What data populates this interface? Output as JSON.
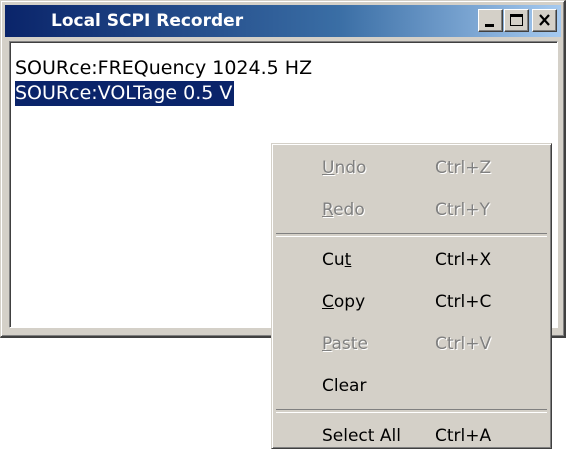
{
  "window": {
    "title": "Local SCPI Recorder",
    "controls": {
      "minimize_icon": "minimize-icon",
      "maximize_icon": "maximize-icon",
      "close_icon": "close-icon"
    }
  },
  "editor": {
    "lines": [
      "SOURce:FREQuency 1024.5 HZ",
      "SOURce:VOLTage 0.5 V"
    ],
    "selected_line_index": 1
  },
  "context_menu": {
    "undo": {
      "pre": "",
      "key": "U",
      "post": "ndo",
      "shortcut": "Ctrl+Z",
      "enabled": false
    },
    "redo": {
      "pre": "",
      "key": "R",
      "post": "edo",
      "shortcut": "Ctrl+Y",
      "enabled": false
    },
    "cut": {
      "pre": "Cu",
      "key": "t",
      "post": "",
      "shortcut": "Ctrl+X",
      "enabled": true
    },
    "copy": {
      "pre": "",
      "key": "C",
      "post": "opy",
      "shortcut": "Ctrl+C",
      "enabled": true
    },
    "paste": {
      "pre": "",
      "key": "P",
      "post": "aste",
      "shortcut": "Ctrl+V",
      "enabled": false
    },
    "clear": {
      "label": "Clear",
      "enabled": true
    },
    "select_all": {
      "label": "Select All",
      "shortcut": "Ctrl+A",
      "enabled": true
    }
  },
  "colors": {
    "title_bar_start": "#0a246a",
    "title_bar_end": "#a6caf0",
    "selection_bg": "#0a246a",
    "menu_bg": "#d4d0c8",
    "disabled_text": "#808080"
  }
}
